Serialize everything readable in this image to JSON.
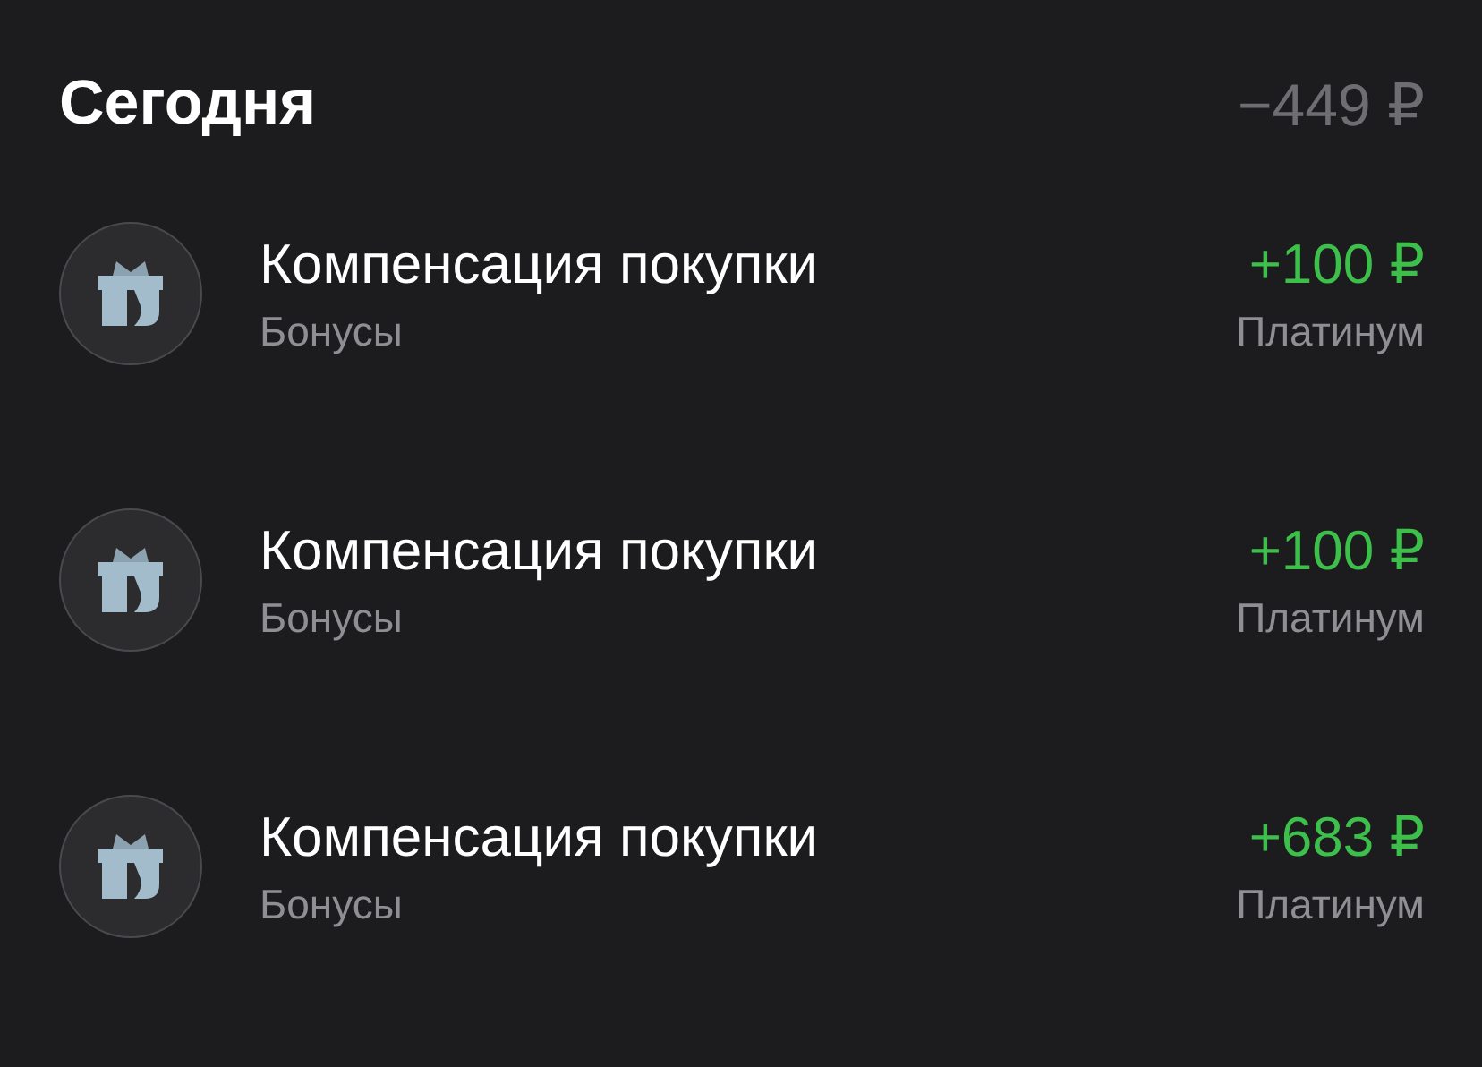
{
  "header": {
    "title": "Сегодня",
    "total": "−449 ₽"
  },
  "transactions": [
    {
      "title": "Компенсация покупки",
      "category": "Бонусы",
      "amount": "+100 ₽",
      "kind": "income",
      "account": "Платинум"
    },
    {
      "title": "Компенсация покупки",
      "category": "Бонусы",
      "amount": "+100 ₽",
      "kind": "income",
      "account": "Платинум"
    },
    {
      "title": "Компенсация покупки",
      "category": "Бонусы",
      "amount": "+683 ₽",
      "kind": "income",
      "account": "Платинум"
    }
  ]
}
